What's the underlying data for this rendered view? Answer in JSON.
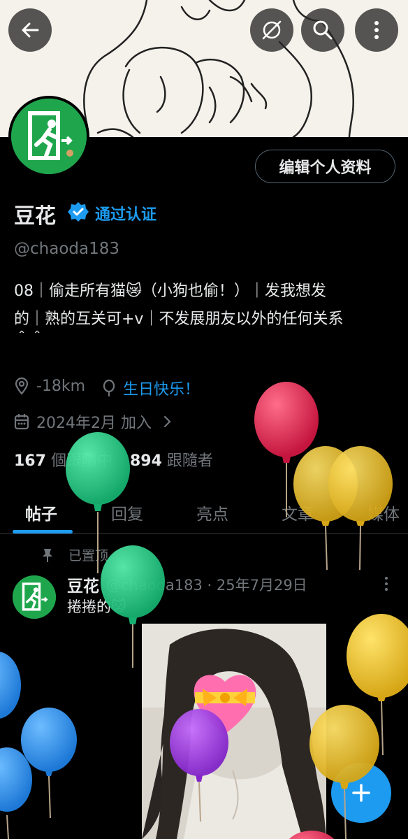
{
  "header": {
    "back_icon": "arrow-left-icon",
    "hide_icon": "eye-slash-icon",
    "search_icon": "search-icon",
    "more_icon": "more-vertical-icon"
  },
  "profile": {
    "edit_button": "编辑个人资料",
    "name": "豆花",
    "verified_label": "通过认证",
    "handle": "@chaoda183",
    "bio_line1": "08｜偷走所有猫😿（小狗也偷！）｜发我想发",
    "bio_line2": "的｜熟的互关可+v｜不发展朋友以外的任何关系",
    "bio_line3": "＾＾",
    "location": "-18km",
    "birthday": "生日快乐！",
    "joined": "2024年2月 加入",
    "following_count": "167",
    "following_label": "個跟隨中",
    "followers_count": "894",
    "followers_label": "跟隨者"
  },
  "tabs": [
    {
      "label": "帖子"
    },
    {
      "label": "回复"
    },
    {
      "label": "亮点"
    },
    {
      "label": "文章"
    },
    {
      "label": "媒体"
    }
  ],
  "post": {
    "pinned_label": "已置顶",
    "author": "豆花",
    "meta": "@chaoda183 · 25年7月29日",
    "text": "捲捲的😺"
  },
  "fab": {
    "icon": "plus-icon",
    "label": "+"
  },
  "colors": {
    "accent": "#1d9bf0",
    "background": "#000000",
    "muted": "#71767b",
    "avatar_green": "#1fa64d"
  }
}
